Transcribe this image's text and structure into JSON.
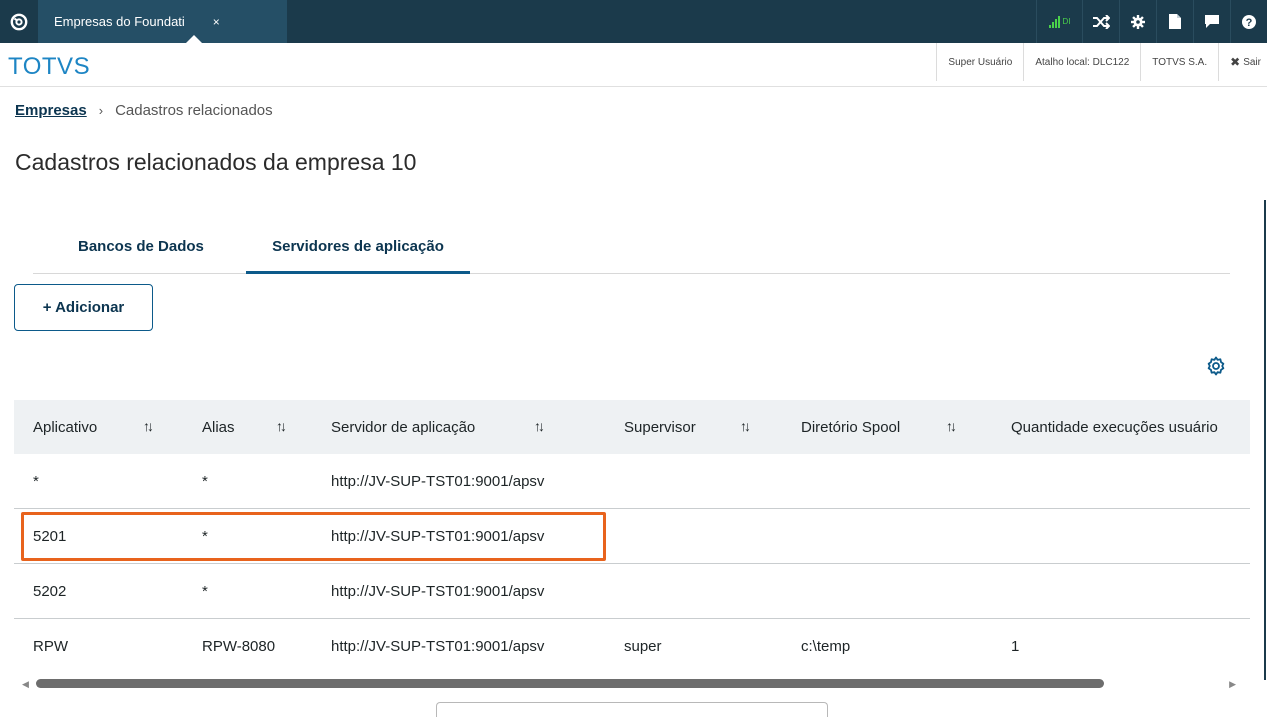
{
  "topbar": {
    "tab_label": "Empresas do Foundati",
    "tab_close": "×",
    "signal_text": "DI"
  },
  "header": {
    "brand": "TOTVS",
    "user": "Super Usuário",
    "shortcut": "Atalho local: DLC122",
    "company": "TOTVS S.A.",
    "logout": "Sair"
  },
  "breadcrumb": {
    "link": "Empresas",
    "separator": "›",
    "current": "Cadastros relacionados"
  },
  "page_title": "Cadastros relacionados da empresa 10",
  "tabs": [
    "Bancos de Dados",
    "Servidores de aplicação"
  ],
  "add_button": "+ Adicionar",
  "table": {
    "columns": [
      "Aplicativo",
      "Alias",
      "Servidor de aplicação",
      "Supervisor",
      "Diretório Spool",
      "Quantidade execuções usuário"
    ],
    "sort_glyph": "↑↓",
    "rows": [
      [
        "*",
        "*",
        "http://JV-SUP-TST01:9001/apsv",
        "",
        "",
        ""
      ],
      [
        "5201",
        "*",
        "http://JV-SUP-TST01:9001/apsv",
        "",
        "",
        ""
      ],
      [
        "5202",
        "*",
        "http://JV-SUP-TST01:9001/apsv",
        "",
        "",
        ""
      ],
      [
        "RPW",
        "RPW-8080",
        "http://JV-SUP-TST01:9001/apsv",
        "super",
        "c:\\temp",
        "1"
      ]
    ]
  },
  "colors": {
    "topbar": "#1b3a4b",
    "accent": "#0c5a8a",
    "brand": "#1d85c4",
    "highlight": "#e8631d"
  }
}
